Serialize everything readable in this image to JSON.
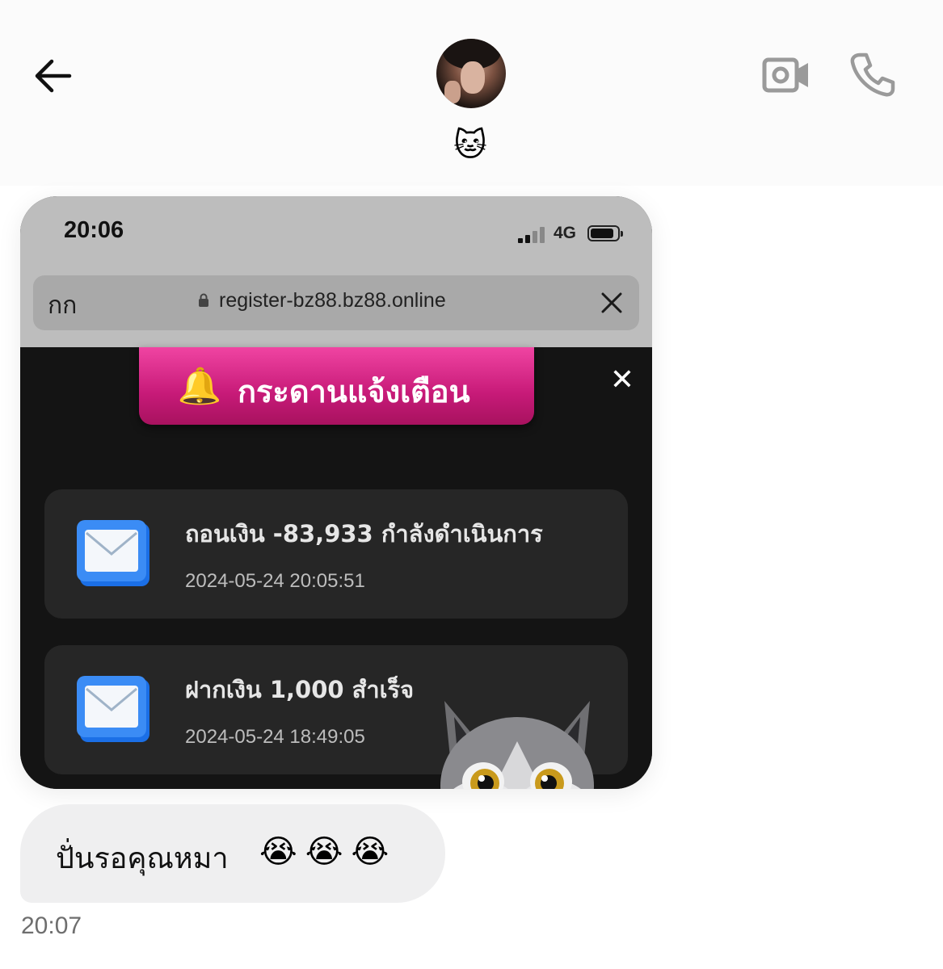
{
  "header": {
    "back_icon": "arrow-left-icon",
    "status_emoji": "🐱",
    "video_icon": "video-camera-icon",
    "call_icon": "phone-icon"
  },
  "screenshot": {
    "status_bar": {
      "time": "20:06",
      "network": "4G"
    },
    "browser": {
      "aa_label": "กก",
      "url": "register-bz88.bz88.online",
      "close_icon": "close-icon"
    },
    "banner": {
      "bell_emoji": "🔔",
      "title": "กระดานแจ้งเตือน",
      "close_glyph": "✕"
    },
    "notifications": [
      {
        "title": "ถอนเงิน -83,933 กำลังดำเนินการ",
        "time": "2024-05-24 20:05:51"
      },
      {
        "title": "ฝากเงิน 1,000 สำเร็จ",
        "time": "2024-05-24 18:49:05"
      }
    ],
    "sticker": "wolf-memoji"
  },
  "message": {
    "text": "ปั่นรอคุณหมา",
    "emojis": "😭😭😭",
    "time": "20:07"
  },
  "colors": {
    "banner": "#d4237f",
    "panel": "#141414",
    "card": "#262626",
    "bubble": "#efeff0"
  }
}
